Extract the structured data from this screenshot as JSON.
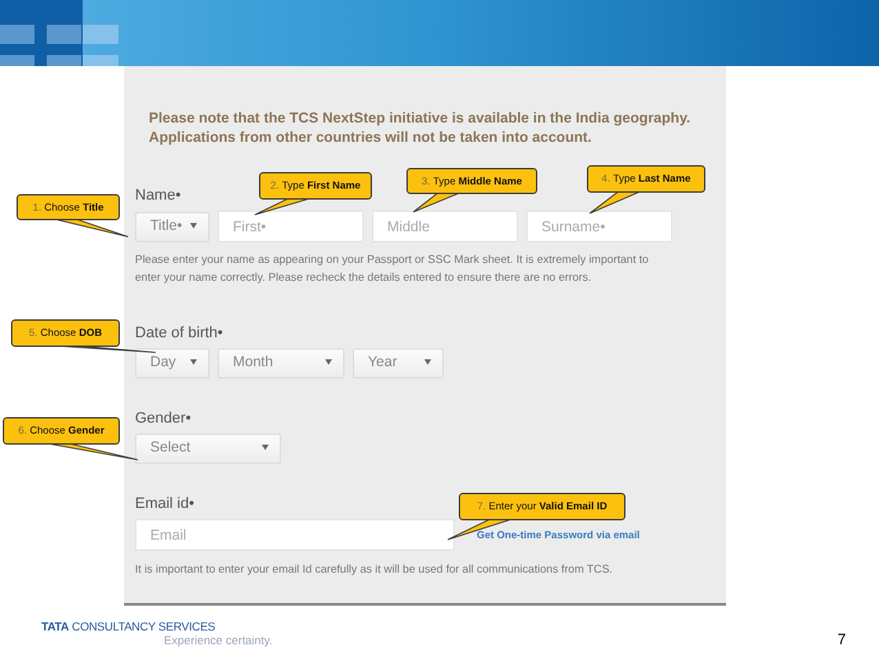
{
  "notice": [
    "Please note that the TCS NextStep initiative is available in the India geography.",
    "Applications from other countries will not be taken into account."
  ],
  "name": {
    "label": "Name•",
    "fields": [
      {
        "kind": "select",
        "placeholder": "Title•"
      },
      {
        "kind": "input",
        "placeholder": "First•"
      },
      {
        "kind": "input",
        "placeholder": "Middle"
      },
      {
        "kind": "input",
        "placeholder": "Surname•"
      }
    ],
    "help": "Please enter your name as appearing on your Passport or SSC Mark sheet. It is extremely important to enter your name correctly. Please recheck the details entered to ensure there are no errors."
  },
  "dob": {
    "label": "Date of birth•",
    "fields": [
      {
        "kind": "select",
        "placeholder": "Day"
      },
      {
        "kind": "select",
        "placeholder": "Month"
      },
      {
        "kind": "select",
        "placeholder": "Year"
      }
    ]
  },
  "gender": {
    "label": "Gender•",
    "fields": [
      {
        "kind": "select",
        "placeholder": "Select"
      }
    ]
  },
  "email": {
    "label": "Email id•",
    "fields": [
      {
        "kind": "input",
        "placeholder": "Email"
      }
    ],
    "link": "Get One-time Password via email",
    "help": "It is important to enter your email Id carefully as it will be used for all communications from TCS."
  },
  "callouts": [
    {
      "number": "1.",
      "text": "Choose **Title**"
    },
    {
      "number": "2.",
      "text": "Type **First Name**"
    },
    {
      "number": "3.",
      "text": "Type **Middle Name**"
    },
    {
      "number": "4.",
      "text": "Type **Last Name**"
    },
    {
      "number": "5.",
      "text": "Choose **DOB**"
    },
    {
      "number": "6.",
      "text": "Choose **Gender**"
    },
    {
      "number": "7.",
      "text": "Enter your **Valid Email ID**"
    }
  ],
  "footer": {
    "brand": "**TATA** CONSULTANCY SERVICES",
    "tagline": "Experience certainty.",
    "page_number": "7"
  }
}
